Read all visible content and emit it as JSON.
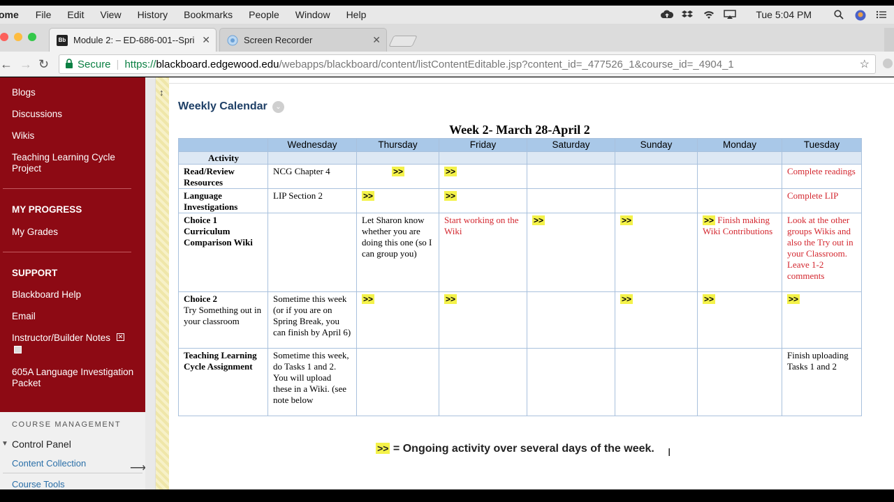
{
  "menubar": {
    "app_name": "ome",
    "items": [
      "File",
      "Edit",
      "View",
      "History",
      "Bookmarks",
      "People",
      "Window",
      "Help"
    ],
    "clock": "Tue 5:04 PM"
  },
  "tabs": [
    {
      "title": "Module 2: – ED-686-001--Spri",
      "favicon": "Bb"
    },
    {
      "title": "Screen Recorder",
      "favicon": "recorder-icon"
    }
  ],
  "address": {
    "secure_label": "Secure",
    "url_scheme": "https://",
    "url_host": "blackboard.edgewood.edu",
    "url_path": "/webapps/blackboard/content/listContentEditable.jsp?content_id=_477526_1&course_id=_4904_1"
  },
  "sidebar": {
    "links_top": [
      "Blogs",
      "Discussions",
      "Wikis",
      "Teaching Learning Cycle Project"
    ],
    "progress_heading": "MY PROGRESS",
    "progress_links": [
      "My Grades"
    ],
    "support_heading": "SUPPORT",
    "support_links": [
      "Blackboard Help",
      "Email",
      "Instructor/Builder Notes",
      "605A Language Investigation Packet"
    ],
    "management_heading": "COURSE MANAGEMENT",
    "control_panel": "Control Panel",
    "management_links": [
      "Content Collection",
      "Course Tools"
    ],
    "accent_color": "#8d0a14"
  },
  "content": {
    "item_title": "Weekly Calendar",
    "week_title": "Week 2- March 28-April 2",
    "columns": [
      "",
      "Wednesday",
      "Thursday",
      "Friday",
      "Saturday",
      "Sunday",
      "Monday",
      "Tuesday"
    ],
    "activity_label": "Activity",
    "rows": [
      {
        "label": "Read/Review Resources",
        "cells": [
          {
            "text": "NCG Chapter 4"
          },
          {
            "mark": ">>",
            "align": "center"
          },
          {
            "mark": ">>"
          },
          {},
          {},
          {},
          {
            "text": "Complete readings",
            "color": "red"
          }
        ]
      },
      {
        "label": "Language Investigations",
        "cells": [
          {
            "text": "LIP Section 2"
          },
          {
            "mark": ">>"
          },
          {
            "mark": ">>"
          },
          {},
          {},
          {},
          {
            "text": "Complete LIP",
            "color": "red"
          }
        ]
      },
      {
        "label": "Choice 1 Curriculum Comparison Wiki",
        "cells": [
          {},
          {
            "text": " Let Sharon know whether you are doing this one (so I can group you)"
          },
          {
            "text": "Start working on the Wiki",
            "color": "red"
          },
          {
            "mark": ">>"
          },
          {
            "mark": ">>"
          },
          {
            "mark": ">>",
            "text": " Finish making Wiki Contributions",
            "color": "red"
          },
          {
            "text": "Look at the other groups Wikis and also the Try out in your Classroom. Leave 1-2 comments",
            "color": "red"
          }
        ]
      },
      {
        "label": "Choice 2",
        "sublabel": "Try Something out in your classroom",
        "cells": [
          {
            "text": "Sometime this week (or if you are on Spring Break, you can finish by April 6)"
          },
          {
            "mark": ">>"
          },
          {
            "mark": ">>"
          },
          {},
          {
            "mark": ">>"
          },
          {
            "mark": ">>"
          },
          {
            "mark": ">>"
          }
        ]
      },
      {
        "label": "Teaching Learning Cycle Assignment",
        "cells": [
          {
            "text": "Sometime this week, do Tasks 1 and 2. You will upload these in a Wiki. (see note below"
          },
          {},
          {},
          {},
          {},
          {},
          {
            "text": "Finish uploading Tasks 1 and 2"
          }
        ]
      }
    ],
    "legend_mark": ">>",
    "legend_text": " = Ongoing activity over several days of the week.",
    "highlight_color": "#f4f24a",
    "note_color": "#d3262e"
  }
}
